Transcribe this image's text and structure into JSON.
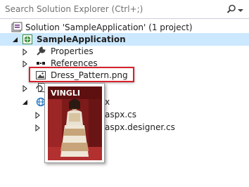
{
  "search": {
    "placeholder": "Search Solution Explorer (Ctrl+;)",
    "icon": "search-icon"
  },
  "tree": {
    "solution_label": "Solution 'SampleApplication' (1 project)",
    "project_label": "SampleApplication",
    "items": [
      {
        "label": "Properties",
        "icon": "wrench-icon"
      },
      {
        "label": "References",
        "icon": "references-icon"
      },
      {
        "label": "Dress_Pattern.png",
        "icon": "image-file-icon"
      },
      {
        "label": "",
        "icon": "web-config-icon"
      },
      {
        "label": "x",
        "icon": "web-page-icon"
      },
      {
        "label": "aspx.cs",
        "icon": "csharp-file-icon"
      },
      {
        "label": "aspx.designer.cs",
        "icon": "csharp-file-icon"
      }
    ]
  },
  "preview": {
    "title_text": "VINGLI",
    "icon": "image-thumbnail"
  },
  "colors": {
    "selection": "#cce8ff",
    "highlight_border": "#d6232b",
    "search_placeholder": "#717171"
  }
}
